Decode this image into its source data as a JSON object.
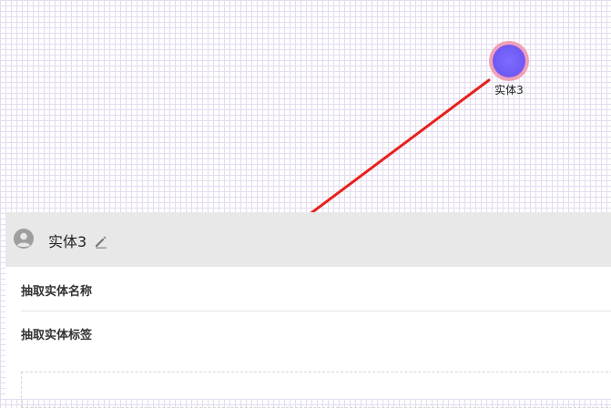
{
  "graph": {
    "node": {
      "label": "实体3",
      "fill_color": "#6f5cf5",
      "ring_color": "#f0a0b8"
    },
    "annotation_arrow_color": "#e8201e"
  },
  "panel": {
    "title": "实体3",
    "avatar_icon": "user-circle-icon",
    "edit_icon": "pencil-icon",
    "fields": [
      {
        "label": "抽取实体名称"
      },
      {
        "label": "抽取实体标签"
      }
    ]
  }
}
